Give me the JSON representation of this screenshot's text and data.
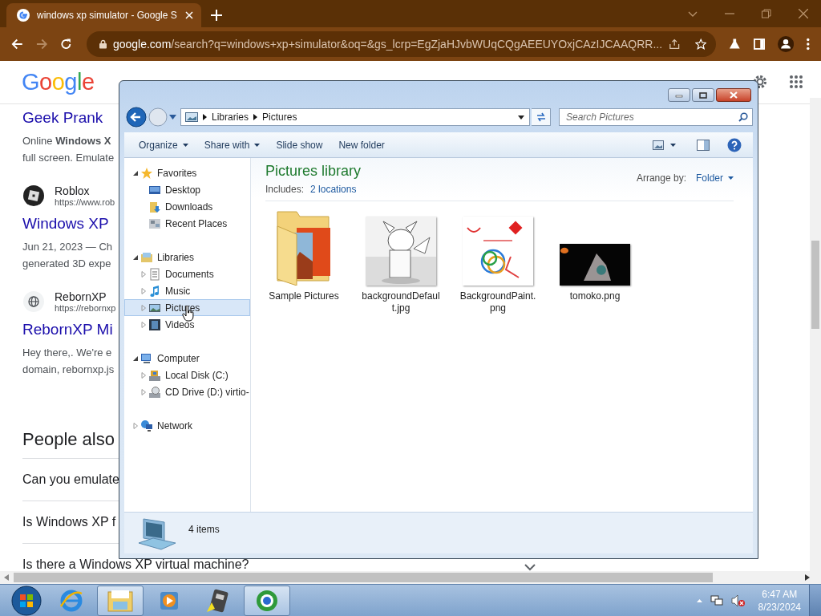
{
  "browser": {
    "tab": {
      "title": "windows xp simulator - Google S"
    },
    "url": {
      "host": "google.com",
      "path": "/search?q=windows+xp+simulator&oq=&gs_lcrp=EgZjaHJvbWUqCQgAEEUYOxjCAzIJCAAQRR..."
    }
  },
  "google_page": {
    "logo": "Google",
    "results": [
      {
        "kind": "title",
        "text": "Geek Prank"
      },
      {
        "kind": "snippet",
        "lines": [
          "Online **Windows X**",
          "full screen. Emulate"
        ]
      },
      {
        "kind": "site",
        "name": "Roblox",
        "url": "https://www.rob"
      },
      {
        "kind": "title",
        "text": "Windows XP"
      },
      {
        "kind": "snippet",
        "lines": [
          "Jun 21, 2023 — Ch",
          "generated 3D expe"
        ]
      },
      {
        "kind": "site",
        "name": "RebornXP",
        "url": "https://rebornxp"
      },
      {
        "kind": "title",
        "text": "RebornXP Mi"
      },
      {
        "kind": "snippet",
        "lines": [
          "Hey there,. We're e",
          "domain, rebornxp.js"
        ]
      }
    ],
    "people_also": "People also",
    "questions": [
      "Can you emulate",
      "Is Windows XP f",
      "Is there a Windows XP virtual machine?"
    ]
  },
  "explorer": {
    "breadcrumb": [
      "Libraries",
      "Pictures"
    ],
    "search_placeholder": "Search Pictures",
    "toolbar": [
      {
        "label": "Organize",
        "dropdown": true
      },
      {
        "label": "Share with",
        "dropdown": true
      },
      {
        "label": "Slide show",
        "dropdown": false
      },
      {
        "label": "New folder",
        "dropdown": false
      }
    ],
    "nav": [
      {
        "label": "Favorites",
        "kind": "favorites",
        "expanded": true,
        "selected": false,
        "children": [
          {
            "label": "Desktop",
            "kind": "desktop",
            "selected": false
          },
          {
            "label": "Downloads",
            "kind": "downloads",
            "selected": false
          },
          {
            "label": "Recent Places",
            "kind": "recent",
            "selected": false
          }
        ]
      },
      {
        "label": "Libraries",
        "kind": "libraries",
        "expanded": true,
        "selected": false,
        "children": [
          {
            "label": "Documents",
            "kind": "documents",
            "expanded": false,
            "selected": false
          },
          {
            "label": "Music",
            "kind": "music",
            "expanded": false,
            "selected": false
          },
          {
            "label": "Pictures",
            "kind": "pictures",
            "expanded": false,
            "selected": true
          },
          {
            "label": "Videos",
            "kind": "videos",
            "expanded": false,
            "selected": false
          }
        ]
      },
      {
        "label": "Computer",
        "kind": "computer",
        "expanded": true,
        "selected": false,
        "children": [
          {
            "label": "Local Disk (C:)",
            "kind": "disk",
            "expanded": false,
            "selected": false
          },
          {
            "label": "CD Drive (D:) virtio-",
            "kind": "cd",
            "expanded": false,
            "selected": false
          }
        ]
      },
      {
        "label": "Network",
        "kind": "network",
        "expanded": false,
        "selected": false
      }
    ],
    "library_title": "Pictures library",
    "includes_label": "Includes:",
    "includes_link": "2 locations",
    "arrange_label": "Arrange by:",
    "arrange_value": "Folder",
    "items": [
      {
        "name": "Sample Pictures",
        "kind": "folder"
      },
      {
        "name": "backgroundDefault.jpg",
        "kind": "sketch"
      },
      {
        "name": "BackgroundPaint.png",
        "kind": "paint"
      },
      {
        "name": "tomoko.png",
        "kind": "dark"
      }
    ],
    "status": "4 items"
  },
  "taskbar": {
    "buttons": [
      {
        "kind": "browser",
        "open": false
      },
      {
        "kind": "explorer",
        "open": true
      },
      {
        "kind": "media",
        "open": false
      },
      {
        "kind": "app",
        "open": false
      },
      {
        "kind": "globe",
        "open": true
      }
    ],
    "time": "6:47 AM",
    "date": "8/23/2024"
  }
}
